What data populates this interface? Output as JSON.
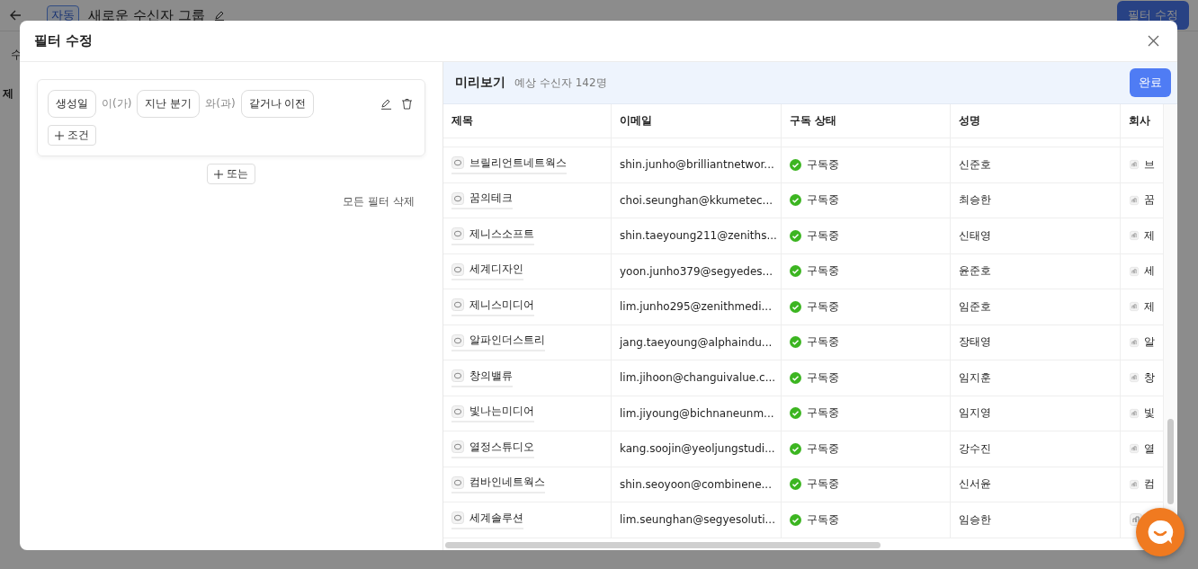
{
  "page": {
    "badge": "자동",
    "title": "새로운 수신자 그룹",
    "action_button": "필터 수정",
    "tab": "수",
    "column": "제"
  },
  "dialog": {
    "title": "필터 수정",
    "filter": {
      "conditions": [
        {
          "field": "생성일",
          "op1": "이(가)",
          "value": "지난 분기",
          "op2": "와(과)",
          "comparison": "같거나 이전"
        }
      ],
      "add_condition": "조건",
      "add_or": "또는",
      "clear_all": "모든 필터 삭제"
    },
    "preview": {
      "title": "미리보기",
      "count": "예상 수신자 142명",
      "done_button": "완료",
      "columns": [
        "제목",
        "이메일",
        "구독 상태",
        "성명",
        "회사"
      ],
      "rows": [
        {
          "title": "브릴리언트네트웍스",
          "email": "shin.junho@brilliantnetwor...",
          "status": {
            "kind": "subscribed",
            "label": "구독중"
          },
          "name": "신준호",
          "company": "브"
        },
        {
          "title": "꿈의테크",
          "email": "choi.seunghan@kkumetec...",
          "status": {
            "kind": "subscribed",
            "label": "구독중"
          },
          "name": "최승한",
          "company": "꿈"
        },
        {
          "title": "제니스소프트",
          "email": "shin.taeyoung211@zeniths...",
          "status": {
            "kind": "subscribed",
            "label": "구독중"
          },
          "name": "신태영",
          "company": "제"
        },
        {
          "title": "세계디자인",
          "email": "yoon.junho379@segyedes...",
          "status": {
            "kind": "subscribed",
            "label": "구독중"
          },
          "name": "윤준호",
          "company": "세"
        },
        {
          "title": "제니스미디어",
          "email": "lim.junho295@zenithmedi...",
          "status": {
            "kind": "subscribed",
            "label": "구독중"
          },
          "name": "임준호",
          "company": "제"
        },
        {
          "title": "알파인더스트리",
          "email": "jang.taeyoung@alphaindu...",
          "status": {
            "kind": "subscribed",
            "label": "구독중"
          },
          "name": "장태영",
          "company": "알"
        },
        {
          "title": "창의밸류",
          "email": "lim.jihoon@changuivalue.c...",
          "status": {
            "kind": "subscribed",
            "label": "구독중"
          },
          "name": "임지훈",
          "company": "창"
        },
        {
          "title": "빛나는미디어",
          "email": "lim.jiyoung@bichnaneunm...",
          "status": {
            "kind": "subscribed",
            "label": "구독중"
          },
          "name": "임지영",
          "company": "빛"
        },
        {
          "title": "열정스튜디오",
          "email": "kang.soojin@yeoljungstudi...",
          "status": {
            "kind": "subscribed",
            "label": "구독중"
          },
          "name": "강수진",
          "company": "열"
        },
        {
          "title": "컴바인네트웍스",
          "email": "shin.seoyoon@combinene...",
          "status": {
            "kind": "subscribed",
            "label": "구독중"
          },
          "name": "신서윤",
          "company": "컴"
        },
        {
          "title": "세계솔루션",
          "email": "lim.seunghan@segyesoluti...",
          "status": {
            "kind": "subscribed",
            "label": "구독중"
          },
          "name": "임승한"
        }
      ]
    }
  }
}
